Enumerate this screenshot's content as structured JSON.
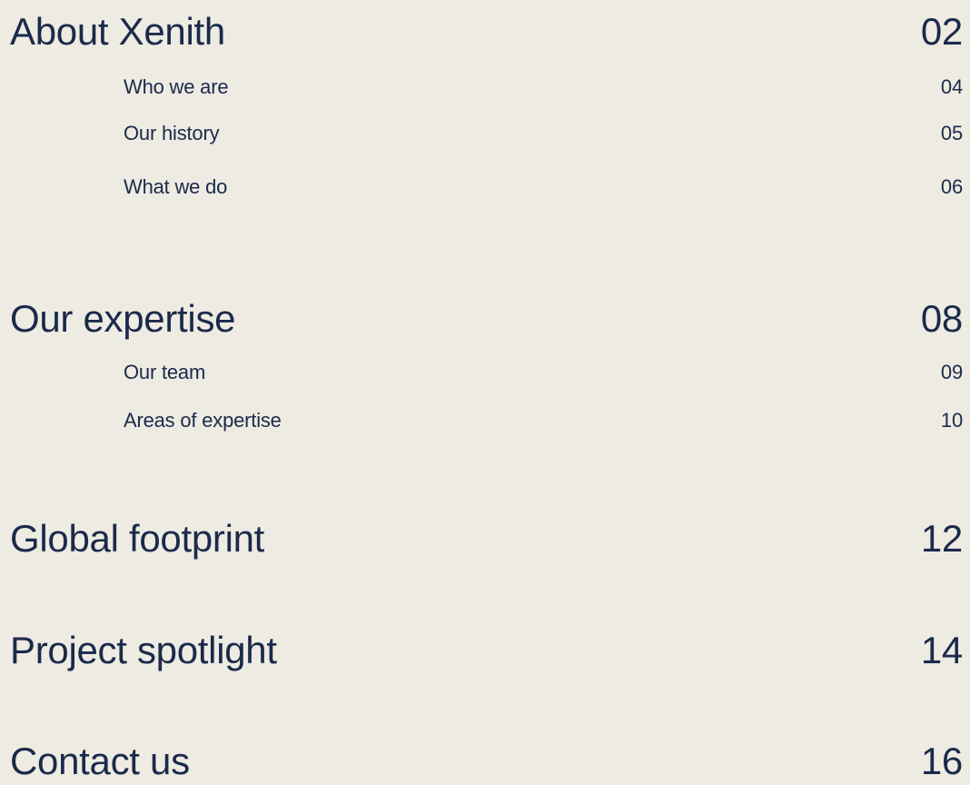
{
  "toc": {
    "sections": [
      {
        "title": "About Xenith",
        "page": "02",
        "subsections": [
          {
            "title": "Who we are",
            "page": "04"
          },
          {
            "title": "Our history",
            "page": "05"
          },
          {
            "title": "What we do",
            "page": "06"
          }
        ]
      },
      {
        "title": "Our expertise",
        "page": "08",
        "subsections": [
          {
            "title": "Our team",
            "page": "09"
          },
          {
            "title": "Areas of expertise",
            "page": "10"
          }
        ]
      },
      {
        "title": "Global footprint",
        "page": "12"
      },
      {
        "title": "Project spotlight",
        "page": "14"
      },
      {
        "title": "Contact us",
        "page": "16"
      }
    ]
  },
  "colors": {
    "background": "#EEEBE3",
    "text": "#1B2A4A"
  }
}
